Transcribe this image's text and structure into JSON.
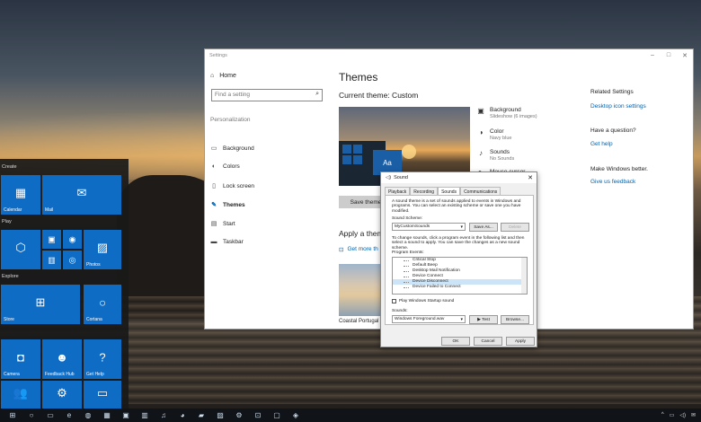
{
  "start_menu": {
    "groups": [
      "Create",
      "Play",
      "Explore"
    ],
    "tiles": [
      {
        "label": "Calendar",
        "icon": "calendar-icon",
        "glyph": "▦"
      },
      {
        "label": "Mail",
        "icon": "mail-icon",
        "glyph": "✉"
      },
      {
        "label": "",
        "icon": "cube-icon",
        "glyph": "⬡"
      },
      {
        "label": "",
        "icon": "film-icon",
        "glyph": "▣"
      },
      {
        "label": "",
        "icon": "disc-icon",
        "glyph": "◉"
      },
      {
        "label": "",
        "icon": "calculator-icon",
        "glyph": "▥"
      },
      {
        "label": "",
        "icon": "camera-small-icon",
        "glyph": "◎"
      },
      {
        "label": "Photos",
        "icon": "photos-icon",
        "glyph": "▨"
      },
      {
        "label": "Store",
        "icon": "store-icon",
        "glyph": "⊞"
      },
      {
        "label": "Cortana",
        "icon": "cortana-icon",
        "glyph": "○"
      },
      {
        "label": "Camera",
        "icon": "camera-icon",
        "glyph": "◘"
      },
      {
        "label": "Feedback Hub",
        "icon": "feedback-icon",
        "glyph": "☻"
      },
      {
        "label": "Get Help",
        "icon": "help-icon",
        "glyph": "?"
      },
      {
        "label": "",
        "icon": "people-icon",
        "glyph": "👥"
      },
      {
        "label": "",
        "icon": "settings-tile-icon",
        "glyph": "⚙"
      },
      {
        "label": "",
        "icon": "sticky-icon",
        "glyph": "▭"
      }
    ]
  },
  "settings": {
    "window_title": "Settings",
    "home": "Home",
    "search_placeholder": "Find a setting",
    "section": "Personalization",
    "nav": [
      {
        "label": "Background",
        "icon": "image-icon",
        "glyph": "▭"
      },
      {
        "label": "Colors",
        "icon": "palette-icon",
        "glyph": "◐"
      },
      {
        "label": "Lock screen",
        "icon": "lock-screen-icon",
        "glyph": "▯"
      },
      {
        "label": "Themes",
        "icon": "brush-icon",
        "glyph": "✎"
      },
      {
        "label": "Start",
        "icon": "start-icon",
        "glyph": "▤"
      },
      {
        "label": "Taskbar",
        "icon": "taskbar-icon",
        "glyph": "▬"
      }
    ],
    "title": "Themes",
    "current_theme": "Current theme: Custom",
    "preview_aa": "Aa",
    "save_theme": "Save theme",
    "apply_theme": "Apply a theme",
    "get_more": "Get more th",
    "thumb_label": "Coastal Portugal",
    "options": [
      {
        "title": "Background",
        "sub": "Slideshow (6 images)",
        "icon": "background-option-icon",
        "glyph": "▣"
      },
      {
        "title": "Color",
        "sub": "Navy blue",
        "icon": "color-option-icon",
        "glyph": "◑"
      },
      {
        "title": "Sounds",
        "sub": "No Sounds",
        "icon": "sound-option-icon",
        "glyph": "♪"
      },
      {
        "title": "Mouse cursor",
        "sub": "",
        "icon": "cursor-option-icon",
        "glyph": "↖"
      }
    ],
    "related": {
      "heading": "Related Settings",
      "desktop_icon": "Desktop icon settings",
      "question": "Have a question?",
      "get_help": "Get help",
      "better": "Make Windows better.",
      "feedback": "Give us feedback"
    }
  },
  "sound_dialog": {
    "title": "Sound",
    "tabs": [
      "Playback",
      "Recording",
      "Sounds",
      "Communications"
    ],
    "active_tab": "Sounds",
    "intro": "A sound theme is a set of sounds applied to events in Windows and programs. You can select an existing scheme or save one you have modified.",
    "scheme_label": "Sound Scheme:",
    "scheme_value": "MyCustomSounds",
    "save_as": "Save As...",
    "delete": "Delete",
    "instructions": "To change sounds, click a program event in the following list and then select a sound to apply. You can save the changes as a new sound scheme.",
    "events_label": "Program Events:",
    "events": [
      "Critical Stop",
      "Default Beep",
      "Desktop Mail Notification",
      "Device Connect",
      "Device Disconnect",
      "Device Failed to Connect"
    ],
    "selected_event": "Device Disconnect",
    "play_startup": "Play Windows Startup sound",
    "sounds_label": "Sounds:",
    "sound_value": "Windows Foreground.wav",
    "test": "Test",
    "browse": "Browse...",
    "ok": "OK",
    "cancel": "Cancel",
    "apply": "Apply"
  },
  "taskbar": {
    "icons": [
      {
        "icon": "windows-logo-icon",
        "glyph": "⊞"
      },
      {
        "icon": "search-icon",
        "glyph": "○"
      },
      {
        "icon": "task-view-icon",
        "glyph": "▭"
      },
      {
        "icon": "edge-icon",
        "glyph": "e"
      },
      {
        "icon": "firefox-icon",
        "glyph": "◍"
      },
      {
        "icon": "calendar-task-icon",
        "glyph": "▦"
      },
      {
        "icon": "app-icon",
        "glyph": "▣"
      },
      {
        "icon": "calculator-task-icon",
        "glyph": "▥"
      },
      {
        "icon": "music-icon",
        "glyph": "♫"
      },
      {
        "icon": "cat-icon",
        "glyph": "◕"
      },
      {
        "icon": "folder-icon",
        "glyph": "▰"
      },
      {
        "icon": "photo-task-icon",
        "glyph": "▨"
      },
      {
        "icon": "settings-task-icon",
        "glyph": "⚙"
      },
      {
        "icon": "store-task-icon",
        "glyph": "⊡"
      },
      {
        "icon": "window-task-icon",
        "glyph": "▢"
      },
      {
        "icon": "shield-task-icon",
        "glyph": "◈"
      }
    ],
    "tray": [
      "^",
      "▭",
      "◁)",
      "✉"
    ]
  }
}
